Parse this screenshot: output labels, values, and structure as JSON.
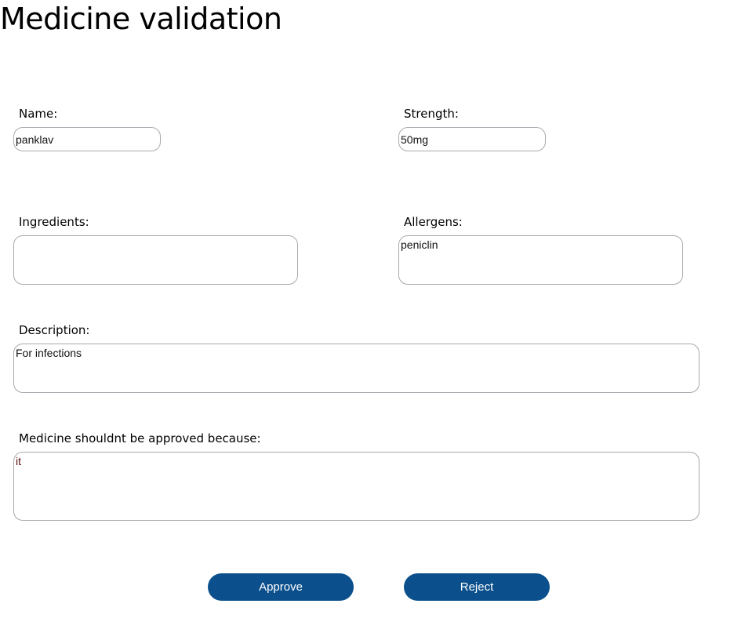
{
  "title": "Medicine validation",
  "fields": {
    "name": {
      "label": "Name:",
      "value": "panklav"
    },
    "strength": {
      "label": "Strength:",
      "value": "50mg"
    },
    "ingredients": {
      "label": "Ingredients:",
      "value": ""
    },
    "allergens": {
      "label": "Allergens:",
      "value": "peniclin"
    },
    "description": {
      "label": "Description:",
      "value": "For infections"
    },
    "reason": {
      "label": "Medicine shouldnt be approved because:",
      "value": "it"
    }
  },
  "buttons": {
    "approve": "Approve",
    "reject": "Reject"
  },
  "colors": {
    "button": "#0b508c"
  }
}
